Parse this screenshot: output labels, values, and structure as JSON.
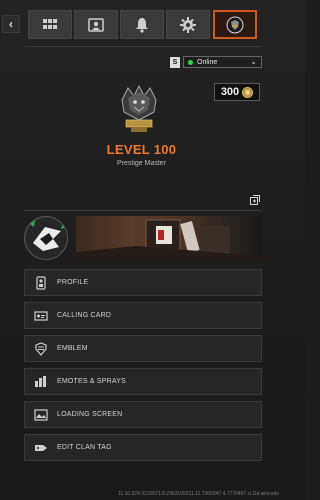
{
  "topbar": {
    "tabs": [
      {
        "name": "grid"
      },
      {
        "name": "social"
      },
      {
        "name": "notifications"
      },
      {
        "name": "settings"
      },
      {
        "name": "profile",
        "active": true
      }
    ]
  },
  "status": {
    "badge": "S",
    "value": "Online",
    "dot_color": "#39d24a"
  },
  "currency": {
    "amount": "300"
  },
  "player": {
    "level": "LEVEL 100",
    "rank_name": "Prestige Master"
  },
  "menu": {
    "items": [
      {
        "label": "PROFILE",
        "icon": "profile-icon"
      },
      {
        "label": "CALLING CARD",
        "icon": "calling-card-icon"
      },
      {
        "label": "EMBLEM",
        "icon": "emblem-icon"
      },
      {
        "label": "EMOTES & SPRAYS",
        "icon": "emotes-icon"
      },
      {
        "label": "LOADING SCREEN",
        "icon": "loading-screen-icon"
      },
      {
        "label": "EDIT CLAN TAG",
        "icon": "clan-tag-icon"
      }
    ]
  },
  "build": "11.10.224.3210571.8.2963105211.11.7300347.4.7770497.cl.Ga.wincode",
  "colors": {
    "accent": "#f07a2a",
    "active_tab_border": "#d05a1e"
  }
}
